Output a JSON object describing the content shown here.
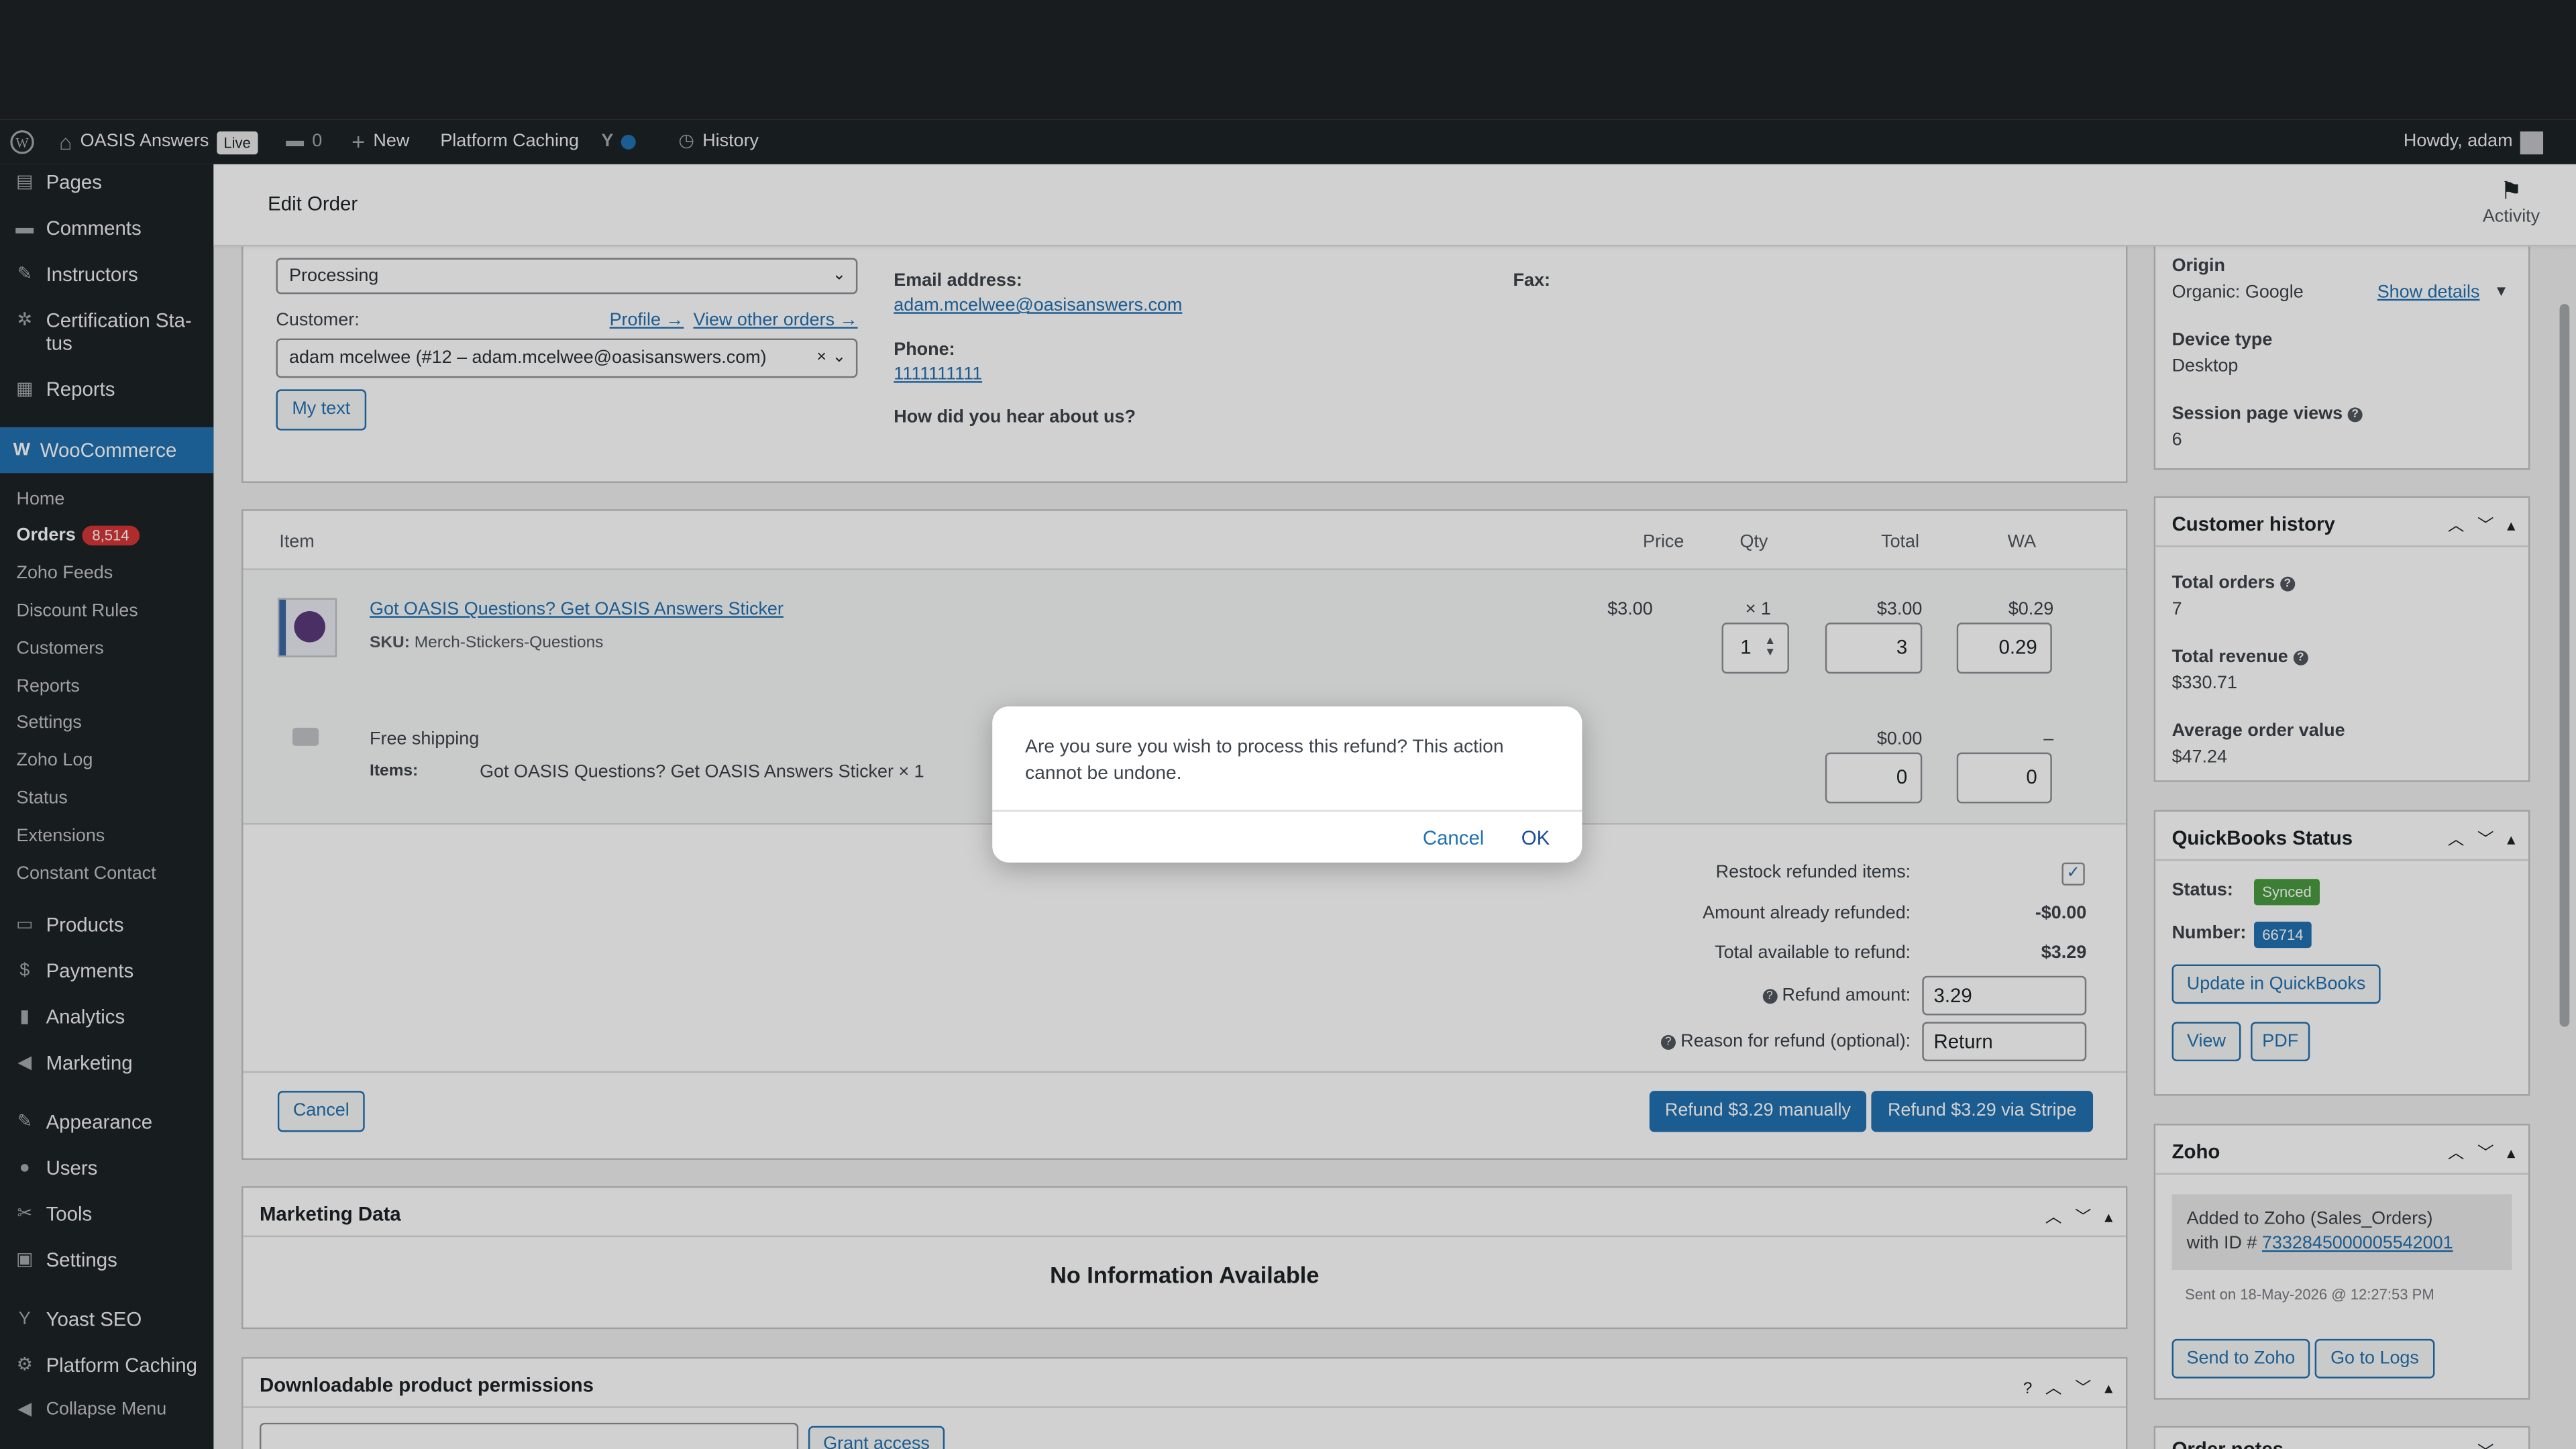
{
  "admin_bar": {
    "site_name": "OASIS Answers",
    "live_badge": "Live",
    "comments_count": "0",
    "new_label": "New",
    "platform_caching": "Platform Caching",
    "history": "History",
    "howdy": "Howdy, adam"
  },
  "sidebar": {
    "pages": "Pages",
    "comments": "Comments",
    "instructors": "Instructors",
    "certification_status": "Certification Sta-tus",
    "reports": "Reports",
    "woocommerce": "WooCommerce",
    "sub": {
      "home": "Home",
      "orders": "Orders",
      "orders_badge": "8,514",
      "zoho_feeds": "Zoho Feeds",
      "discount_rules": "Discount Rules",
      "customers": "Customers",
      "reports": "Reports",
      "settings": "Settings",
      "zoho_log": "Zoho Log",
      "status": "Status",
      "extensions": "Extensions",
      "constant_contact": "Constant Contact"
    },
    "products": "Products",
    "payments": "Payments",
    "analytics": "Analytics",
    "marketing": "Marketing",
    "appearance": "Appearance",
    "users": "Users",
    "tools": "Tools",
    "settings": "Settings",
    "yoast": "Yoast SEO",
    "platform_caching": "Platform Caching",
    "collapse": "Collapse Menu"
  },
  "header": {
    "title": "Edit Order",
    "activity": "Activity"
  },
  "order": {
    "status_value": "Processing",
    "customer_label": "Customer:",
    "profile_link": "Profile →",
    "view_other_orders": "View other orders →",
    "customer_value": "adam mcelwee (#12 – adam.mcelwee@oasisanswers.com)",
    "my_text_button": "My text",
    "email_label": "Email address:",
    "email_value": "adam.mcelwee@oasisanswers.com",
    "phone_label": "Phone:",
    "phone_value": "1111111111",
    "hear_label": "How did you hear about us?",
    "fax_label": "Fax:"
  },
  "items": {
    "headers": {
      "item": "Item",
      "price": "Price",
      "qty": "Qty",
      "total": "Total",
      "wa": "WA"
    },
    "product_name": "Got OASIS Questions? Get OASIS Answers Sticker",
    "sku_label": "SKU:",
    "sku_value": "Merch-Stickers-Questions",
    "price": "$3.00",
    "qty_mult": "× 1",
    "total": "$3.00",
    "wa": "$0.29",
    "qty_input": "1",
    "total_input": "3",
    "wa_input": "0.29",
    "shipping_name": "Free shipping",
    "shipping_items_label": "Items:",
    "shipping_items_value": "Got OASIS Questions? Get OASIS Answers Sticker × 1",
    "shipping_total": "$0.00",
    "shipping_wa": "–",
    "shipping_total_input": "0",
    "shipping_wa_input": "0"
  },
  "refund": {
    "restock_label": "Restock refunded items:",
    "already_label": "Amount already refunded:",
    "already_value": "-$0.00",
    "available_label": "Total available to refund:",
    "available_value": "$3.29",
    "amount_label": "Refund amount:",
    "amount_value": "3.29",
    "reason_label": "Reason for refund (optional):",
    "reason_value": "Return",
    "cancel_button": "Cancel",
    "manual_button": "Refund $3.29 manually",
    "stripe_button": "Refund $3.29 via Stripe"
  },
  "marketing": {
    "title": "Marketing Data",
    "empty": "No Information Available"
  },
  "downloads": {
    "title": "Downloadable product permissions",
    "grant_button": "Grant access"
  },
  "attribution": {
    "origin_label": "Origin",
    "origin_value": "Organic: Google",
    "show_details": "Show details",
    "device_label": "Device type",
    "device_value": "Desktop",
    "views_label": "Session page views",
    "views_value": "6"
  },
  "customer_history": {
    "title": "Customer history",
    "total_orders_label": "Total orders",
    "total_orders_value": "7",
    "total_revenue_label": "Total revenue",
    "total_revenue_value": "$330.71",
    "aov_label": "Average order value",
    "aov_value": "$47.24"
  },
  "quickbooks": {
    "title": "QuickBooks Status",
    "status_label": "Status:",
    "status_value": "Synced",
    "number_label": "Number:",
    "number_value": "66714",
    "update_button": "Update in QuickBooks",
    "view_button": "View",
    "pdf_button": "PDF",
    "synced_color": "#4a9a3f",
    "number_color": "#2271b1"
  },
  "zoho": {
    "title": "Zoho",
    "added_text": "Added to Zoho (Sales_Orders)",
    "with_id": "with ID #",
    "id_value": "7332845000005542001",
    "sent_on": "Sent on 18-May-2026 @ 12:27:53 PM",
    "send_button": "Send to Zoho",
    "logs_button": "Go to Logs"
  },
  "order_notes": {
    "title": "Order notes"
  },
  "modal": {
    "message": "Are you sure you wish to process this refund? This action cannot be undone.",
    "cancel": "Cancel",
    "ok": "OK"
  }
}
